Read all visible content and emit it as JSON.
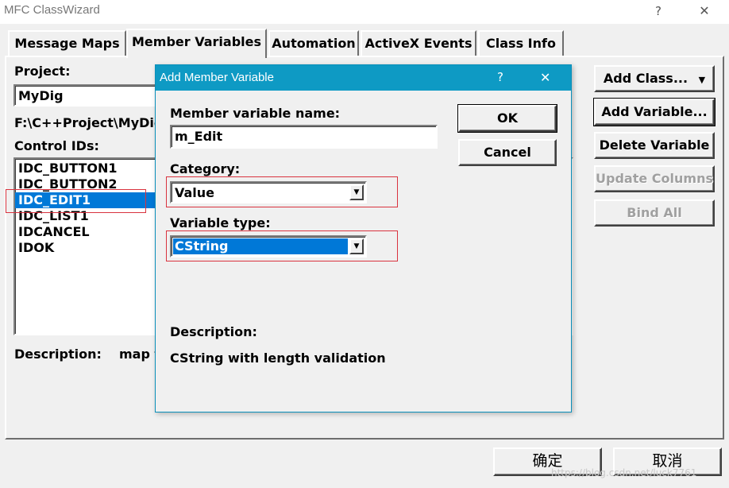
{
  "window": {
    "title": "MFC ClassWizard",
    "help_glyph": "?",
    "close_glyph": "✕"
  },
  "tabs": [
    "Message Maps",
    "Member Variables",
    "Automation",
    "ActiveX Events",
    "Class Info"
  ],
  "project": {
    "label": "Project:",
    "value": "MyDig",
    "path": "F:\\C++Project\\MyDig\\M"
  },
  "control_ids": {
    "label": "Control IDs:",
    "items": [
      "IDC_BUTTON1",
      "IDC_BUTTON2",
      "IDC_EDIT1",
      "IDC_LIST1",
      "IDCANCEL",
      "IDOK"
    ],
    "selected": "IDC_EDIT1"
  },
  "description": {
    "label": "Description:",
    "value": "map t"
  },
  "side_buttons": {
    "add_class": "Add Class...",
    "add_class_arrow": "▼",
    "add_variable": "Add Variable...",
    "delete_variable": "Delete Variable",
    "update_columns": "Update Columns",
    "bind_all": "Bind All"
  },
  "bottom_buttons": {
    "ok": "确定",
    "cancel": "取消"
  },
  "watermark": "https://blog.csdn.net/luck7761",
  "dialog": {
    "title": "Add Member Variable",
    "help_glyph": "?",
    "close_glyph": "✕",
    "name_label": "Member variable name:",
    "name_value": "m_Edit",
    "category_label": "Category:",
    "category_value": "Value",
    "type_label": "Variable type:",
    "type_value": "CString",
    "ok": "OK",
    "cancel": "Cancel",
    "description_label": "Description:",
    "description_value": "CString with length validation"
  },
  "colors": {
    "selection": "#0078d7",
    "dialog_titlebar": "#0e9ac4",
    "highlight_box": "#d9333f"
  }
}
